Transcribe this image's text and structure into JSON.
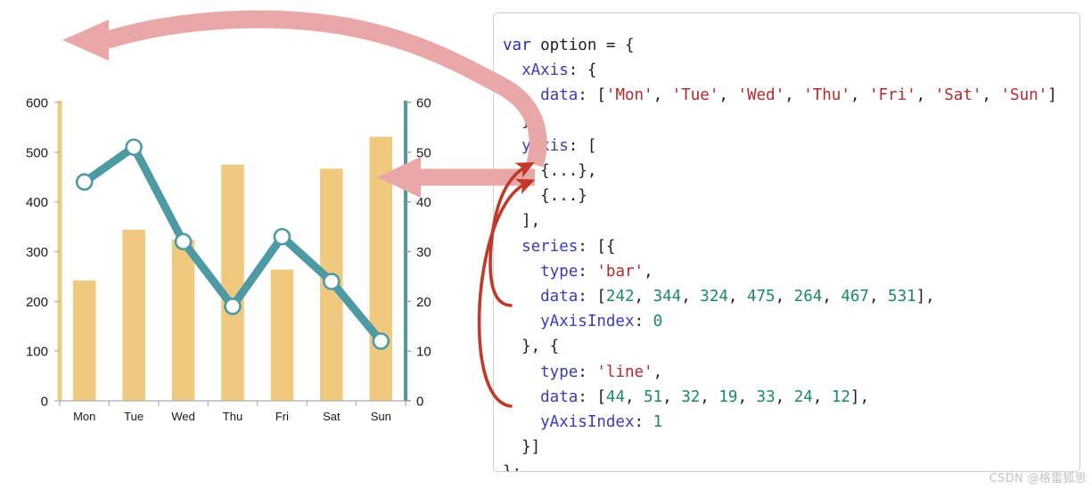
{
  "chart_data": {
    "type": "bar",
    "title": "",
    "xlabel": "",
    "ylabel": "",
    "grid": false,
    "legend_position": "none",
    "categories": [
      "Mon",
      "Tue",
      "Wed",
      "Thu",
      "Fri",
      "Sat",
      "Sun"
    ],
    "series": [
      {
        "name": "bar",
        "type": "bar",
        "yAxisIndex": 0,
        "color": "#efc97e",
        "values": [
          242,
          344,
          324,
          475,
          264,
          467,
          531
        ]
      },
      {
        "name": "line",
        "type": "line",
        "yAxisIndex": 1,
        "color": "#4e9aa2",
        "values": [
          44,
          51,
          32,
          19,
          33,
          24,
          12
        ]
      }
    ],
    "axes": {
      "left": {
        "index": 0,
        "color": "#efc97e",
        "ylim": [
          0,
          600
        ],
        "tick_step": 100,
        "ticks": [
          "0",
          "100",
          "200",
          "300",
          "400",
          "500",
          "600"
        ]
      },
      "right": {
        "index": 1,
        "color": "#4e9aa2",
        "ylim": [
          0,
          60
        ],
        "tick_step": 10,
        "ticks": [
          "0",
          "10",
          "20",
          "30",
          "40",
          "50",
          "60"
        ]
      }
    }
  },
  "code": {
    "language": "javascript",
    "lines": [
      [
        {
          "t": "var",
          "c": "kw"
        },
        {
          "t": " option ",
          "c": "pun"
        },
        {
          "t": "= {",
          "c": "pun"
        }
      ],
      [
        {
          "t": "  xAxis",
          "c": "key"
        },
        {
          "t": ": {",
          "c": "pun"
        }
      ],
      [
        {
          "t": "    data",
          "c": "key"
        },
        {
          "t": ": [",
          "c": "pun"
        },
        {
          "t": "'Mon'",
          "c": "str"
        },
        {
          "t": ", ",
          "c": "pun"
        },
        {
          "t": "'Tue'",
          "c": "str"
        },
        {
          "t": ", ",
          "c": "pun"
        },
        {
          "t": "'Wed'",
          "c": "str"
        },
        {
          "t": ", ",
          "c": "pun"
        },
        {
          "t": "'Thu'",
          "c": "str"
        },
        {
          "t": ", ",
          "c": "pun"
        },
        {
          "t": "'Fri'",
          "c": "str"
        },
        {
          "t": ", ",
          "c": "pun"
        },
        {
          "t": "'Sat'",
          "c": "str"
        },
        {
          "t": ", ",
          "c": "pun"
        },
        {
          "t": "'Sun'",
          "c": "str"
        },
        {
          "t": "]",
          "c": "pun"
        }
      ],
      [
        {
          "t": "  },",
          "c": "pun"
        }
      ],
      [
        {
          "t": "  yAxis",
          "c": "key"
        },
        {
          "t": ": [",
          "c": "pun"
        }
      ],
      [
        {
          "t": "    {...},",
          "c": "pun"
        }
      ],
      [
        {
          "t": "    {...}",
          "c": "pun"
        }
      ],
      [
        {
          "t": "  ],",
          "c": "pun"
        }
      ],
      [
        {
          "t": "  series",
          "c": "key"
        },
        {
          "t": ": [{",
          "c": "pun"
        }
      ],
      [
        {
          "t": "    type",
          "c": "key"
        },
        {
          "t": ": ",
          "c": "pun"
        },
        {
          "t": "'bar'",
          "c": "str"
        },
        {
          "t": ",",
          "c": "pun"
        }
      ],
      [
        {
          "t": "    data",
          "c": "key"
        },
        {
          "t": ": [",
          "c": "pun"
        },
        {
          "t": "242",
          "c": "num"
        },
        {
          "t": ", ",
          "c": "pun"
        },
        {
          "t": "344",
          "c": "num"
        },
        {
          "t": ", ",
          "c": "pun"
        },
        {
          "t": "324",
          "c": "num"
        },
        {
          "t": ", ",
          "c": "pun"
        },
        {
          "t": "475",
          "c": "num"
        },
        {
          "t": ", ",
          "c": "pun"
        },
        {
          "t": "264",
          "c": "num"
        },
        {
          "t": ", ",
          "c": "pun"
        },
        {
          "t": "467",
          "c": "num"
        },
        {
          "t": ", ",
          "c": "pun"
        },
        {
          "t": "531",
          "c": "num"
        },
        {
          "t": "],",
          "c": "pun"
        }
      ],
      [
        {
          "t": "    yAxisIndex",
          "c": "key"
        },
        {
          "t": ": ",
          "c": "pun"
        },
        {
          "t": "0",
          "c": "num"
        }
      ],
      [
        {
          "t": "  }, {",
          "c": "pun"
        }
      ],
      [
        {
          "t": "    type",
          "c": "key"
        },
        {
          "t": ": ",
          "c": "pun"
        },
        {
          "t": "'line'",
          "c": "str"
        },
        {
          "t": ",",
          "c": "pun"
        }
      ],
      [
        {
          "t": "    data",
          "c": "key"
        },
        {
          "t": ": [",
          "c": "pun"
        },
        {
          "t": "44",
          "c": "num"
        },
        {
          "t": ", ",
          "c": "pun"
        },
        {
          "t": "51",
          "c": "num"
        },
        {
          "t": ", ",
          "c": "pun"
        },
        {
          "t": "32",
          "c": "num"
        },
        {
          "t": ", ",
          "c": "pun"
        },
        {
          "t": "19",
          "c": "num"
        },
        {
          "t": ", ",
          "c": "pun"
        },
        {
          "t": "33",
          "c": "num"
        },
        {
          "t": ", ",
          "c": "pun"
        },
        {
          "t": "24",
          "c": "num"
        },
        {
          "t": ", ",
          "c": "pun"
        },
        {
          "t": "12",
          "c": "num"
        },
        {
          "t": "],",
          "c": "pun"
        }
      ],
      [
        {
          "t": "    yAxisIndex",
          "c": "key"
        },
        {
          "t": ": ",
          "c": "pun"
        },
        {
          "t": "1",
          "c": "num"
        }
      ],
      [
        {
          "t": "  }]",
          "c": "pun"
        }
      ],
      [
        {
          "t": "};",
          "c": "pun"
        }
      ]
    ]
  },
  "annotations": {
    "pink_arrow_top": "xAxis data maps to chart category labels",
    "pink_arrow_right": "yAxis array maps to the two value axes",
    "red_arrow_0": "yAxisIndex 0 points to first yAxis",
    "red_arrow_1": "yAxisIndex 1 points to second yAxis",
    "pink_color": "#e9a7a7",
    "red_color": "#c0392b"
  },
  "watermark": {
    "text": "CSDN @格雷狐思"
  }
}
